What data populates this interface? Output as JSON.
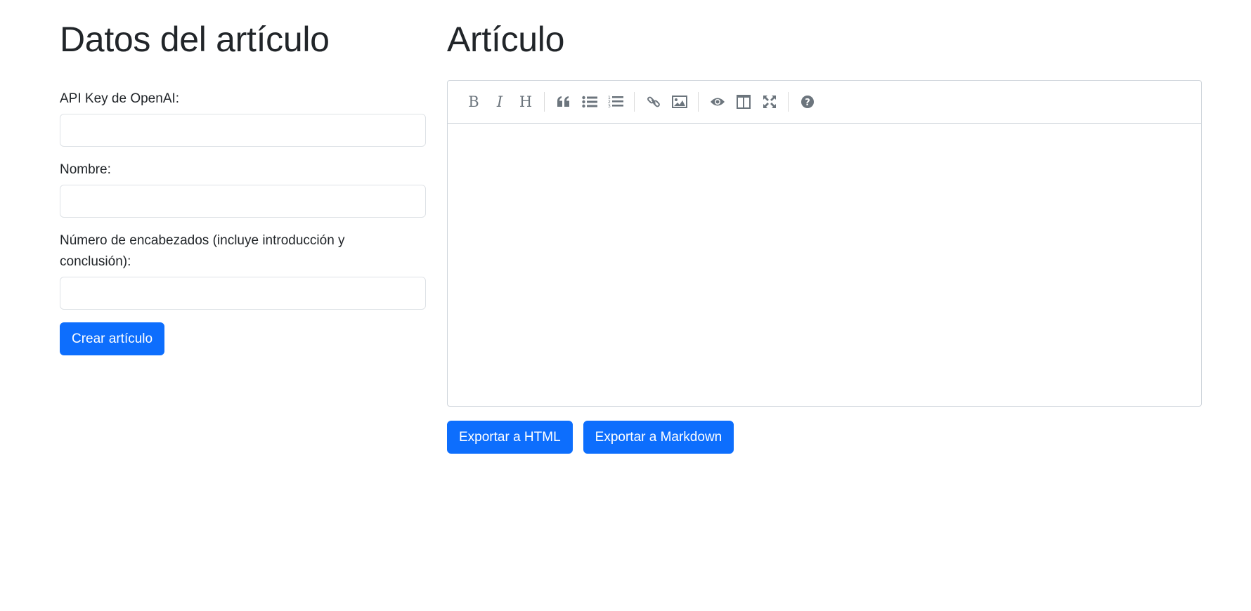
{
  "left": {
    "title": "Datos del artículo",
    "fields": [
      {
        "label": "API Key de OpenAI:",
        "value": "",
        "placeholder": ""
      },
      {
        "label": "Nombre:",
        "value": "",
        "placeholder": ""
      },
      {
        "label_line1": "Número de encabezados (incluye introducción y",
        "label_line2": "conclusión):",
        "value": "",
        "placeholder": ""
      }
    ],
    "create_button": "Crear artículo"
  },
  "right": {
    "title": "Artículo",
    "toolbar": [
      "bold-icon",
      "italic-icon",
      "heading-icon",
      "quote-icon",
      "unordered-list-icon",
      "ordered-list-icon",
      "link-icon",
      "image-icon",
      "preview-icon",
      "side-by-side-icon",
      "fullscreen-icon",
      "help-icon"
    ],
    "editor_content": "",
    "export_html": "Exportar a HTML",
    "export_markdown": "Exportar a Markdown"
  },
  "colors": {
    "primary": "#0d6efd",
    "icon": "#6c757d",
    "border": "#dee2e6"
  }
}
